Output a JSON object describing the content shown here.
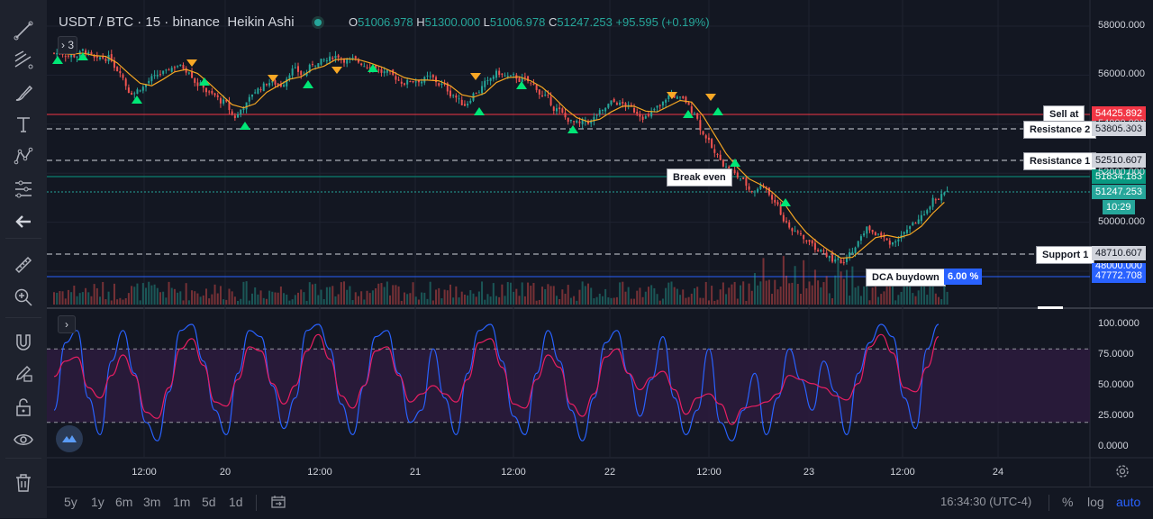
{
  "header": {
    "symbol": "USDT / BTC",
    "interval": "15",
    "exchange": "binance",
    "chart_style": "Heikin Ashi",
    "o_key": "O",
    "o_val": "51006.978",
    "h_key": "H",
    "h_val": "51300.000",
    "l_key": "L",
    "l_val": "51006.978",
    "c_key": "C",
    "c_val": "51247.253",
    "change": "+95.595 (+0.19%)",
    "indicator_count": "3"
  },
  "price_axis": [
    "58000.000",
    "56000.000",
    "54000.000",
    "52000.000",
    "50000.000",
    "48000.000"
  ],
  "oscillator_axis": [
    "100.0000",
    "75.0000",
    "50.0000",
    "25.0000",
    "0.0000"
  ],
  "time_axis": [
    "12:00",
    "20",
    "12:00",
    "21",
    "12:00",
    "22",
    "12:00",
    "23",
    "12:00",
    "24"
  ],
  "price_labels": {
    "sell": "54425.892",
    "res2": "53805.303",
    "res1": "52510.607",
    "breakeven": "51834.183",
    "current": "51247.253",
    "countdown": "10:29",
    "support1": "48710.607",
    "dca": "47772.708",
    "hidden": "48000.000"
  },
  "annotations": {
    "sell": "Sell at",
    "res2": "Resistance 2",
    "res1": "Resistance 1",
    "breakeven": "Break even",
    "support1": "Support 1",
    "dca": "DCA buydown",
    "dca_pct": "6.00 %"
  },
  "bottom_bar": {
    "ranges": [
      "5y",
      "1y",
      "6m",
      "3m",
      "1m",
      "5d",
      "1d"
    ],
    "clock": "16:34:30 (UTC-4)",
    "percent": "%",
    "log": "log",
    "auto": "auto"
  },
  "colors": {
    "up": "#26a69a",
    "down": "#ef5350",
    "sell_line": "#f23645",
    "breakeven_line": "#089981",
    "dca_line": "#2962ff",
    "ma": "#f5a623",
    "stoch_k": "#2962ff",
    "stoch_d": "#e91e63",
    "stoch_band": "#2d1b3d"
  },
  "toolbar_icons": [
    "trend-line-icon",
    "fib-icon",
    "brush-icon",
    "text-icon",
    "pattern-icon",
    "forecast-icon",
    "back-arrow-icon",
    "ruler-icon",
    "zoom-in-icon",
    "magnet-icon",
    "lock-pencil-icon",
    "unlock-icon",
    "eye-icon",
    "trash-icon"
  ],
  "chart_data": {
    "type": "candlestick",
    "title": "USDT / BTC 15 binance Heikin Ashi",
    "ylim": [
      47000,
      58500
    ],
    "oscillator_ylim": [
      0,
      100
    ],
    "series": [
      {
        "name": "close",
        "values": [
          56900,
          56800,
          57000,
          56600,
          56700,
          56200,
          55300,
          55500,
          55900,
          56100,
          56400,
          56200,
          55600,
          55200,
          54900,
          54300,
          54800,
          55400,
          55700,
          55600,
          56200,
          56000,
          56500,
          56600,
          56800,
          56600,
          56500,
          56400,
          56100,
          55900,
          55700,
          55800,
          55900,
          55600,
          55200,
          54800,
          55300,
          55700,
          56100,
          55900,
          55800,
          55600,
          55100,
          54600,
          54200,
          54000,
          54100,
          54500,
          54900,
          54800,
          54500,
          54300,
          54700,
          55200,
          55000,
          54500,
          53500,
          52700,
          52200,
          51800,
          51300,
          51500,
          50900,
          50000,
          49500,
          49200,
          48800,
          48500,
          48300,
          48900,
          49700,
          49500,
          49200,
          49400,
          49900,
          50200,
          51000,
          51247
        ]
      },
      {
        "name": "stoch_k",
        "values": [
          30,
          85,
          95,
          40,
          10,
          70,
          95,
          60,
          20,
          5,
          45,
          95,
          100,
          70,
          30,
          10,
          60,
          95,
          90,
          50,
          15,
          40,
          95,
          100,
          80,
          35,
          10,
          50,
          90,
          95,
          60,
          20,
          30,
          80,
          40,
          10,
          60,
          95,
          100,
          70,
          25,
          10,
          60,
          95,
          70,
          30,
          5,
          40,
          85,
          95,
          60,
          25,
          55,
          90,
          40,
          10,
          30,
          80,
          20,
          5,
          30,
          60,
          10,
          40,
          80,
          55,
          30,
          70,
          45,
          10,
          60,
          85,
          100,
          90,
          40,
          15,
          80,
          100
        ]
      }
    ]
  }
}
